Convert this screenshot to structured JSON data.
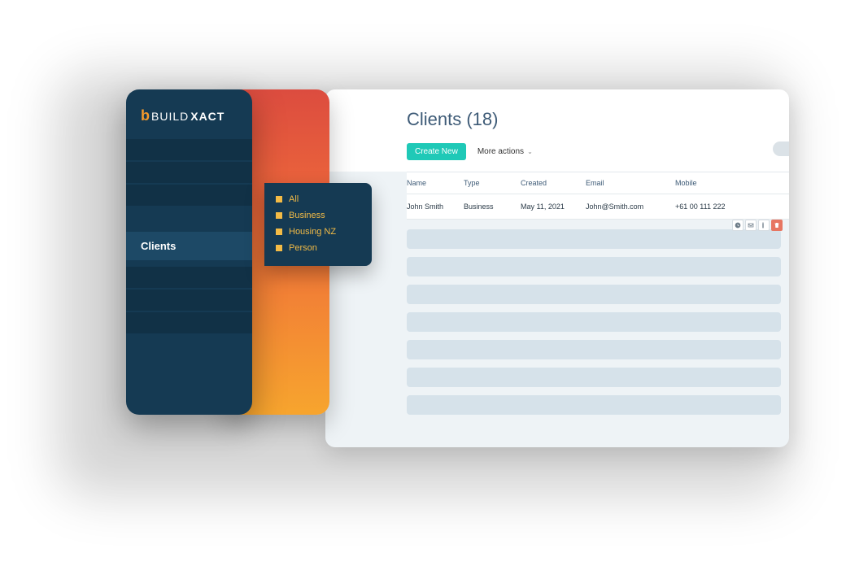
{
  "brand": {
    "prefix": "b",
    "part1": "BUILD",
    "part2": "XACT"
  },
  "sidebar": {
    "active_label": "Clients"
  },
  "flyout": {
    "items": [
      {
        "label": "All"
      },
      {
        "label": "Business"
      },
      {
        "label": "Housing NZ"
      },
      {
        "label": "Person"
      }
    ]
  },
  "page": {
    "title": "Clients (18)"
  },
  "toolbar": {
    "create_label": "Create New",
    "more_label": "More actions"
  },
  "table": {
    "headers": {
      "name": "Name",
      "type": "Type",
      "created": "Created",
      "email": "Email",
      "mobile": "Mobile"
    },
    "row": {
      "name": "John Smith",
      "type": "Business",
      "created": "May 11, 2021",
      "email": "John@Smith.com",
      "mobile": "+61 00 111 222"
    }
  }
}
